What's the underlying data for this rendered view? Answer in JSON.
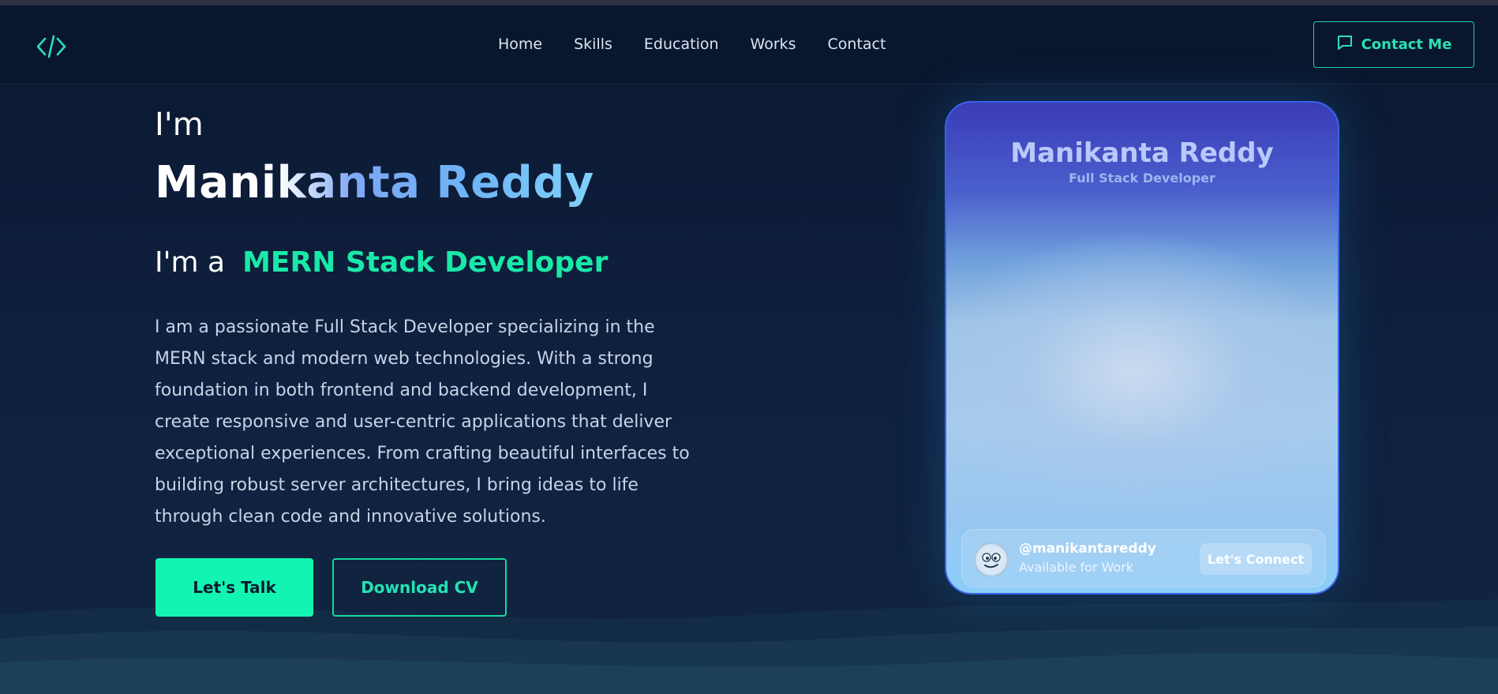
{
  "nav": {
    "logo_icon": "code-brackets-icon",
    "links": [
      "Home",
      "Skills",
      "Education",
      "Works",
      "Contact"
    ],
    "contact_button": "Contact Me",
    "contact_icon": "chat-bubble-icon"
  },
  "hero": {
    "intro": "I'm",
    "name": "Manikanta Reddy",
    "role_prefix": "I'm a",
    "role": "MERN Stack Developer",
    "bio": "I am a passionate Full Stack Developer specializing in the MERN stack and modern web technologies. With a strong foundation in both frontend and backend development, I create responsive and user-centric applications that deliver exceptional experiences. From crafting beautiful interfaces to building robust server architectures, I bring ideas to life through clean code and innovative solutions.",
    "talk_button": "Let's Talk",
    "cv_button": "Download CV"
  },
  "card": {
    "name": "Manikanta Reddy",
    "title": "Full Stack Developer",
    "handle": "@manikantareddy",
    "status": "Available for Work",
    "connect_button": "Let's Connect",
    "avatar_icon": "emoji-avatar-icon"
  },
  "colors": {
    "accent": "#12f5b2",
    "background": "#0d1b33",
    "card_border": "#3b63ea"
  }
}
